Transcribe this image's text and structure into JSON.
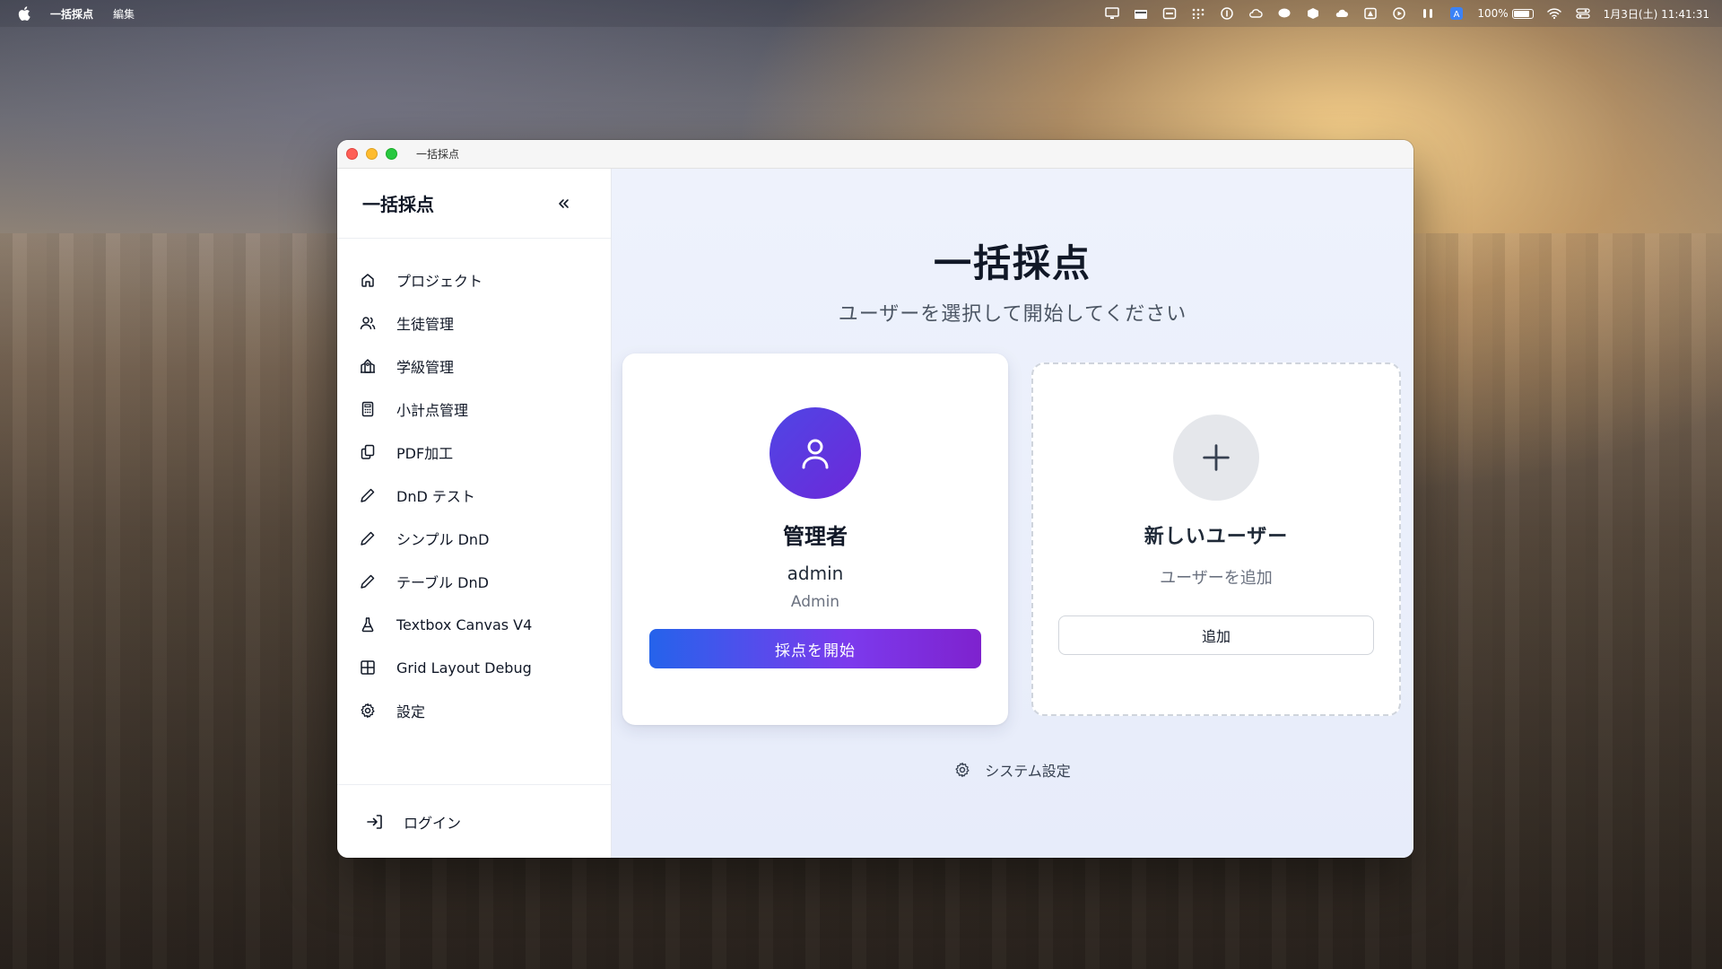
{
  "menubar": {
    "app_name": "一括採点",
    "menu_edit": "編集",
    "battery_percent": "100%",
    "datetime": "1月3日(土) 11:41:31",
    "input_indicator": "A"
  },
  "window": {
    "title": "一括採点"
  },
  "sidebar": {
    "title": "一括採点",
    "collapse_label": "«",
    "items": [
      {
        "label": "プロジェクト",
        "icon": "home-icon"
      },
      {
        "label": "生徒管理",
        "icon": "users-icon"
      },
      {
        "label": "学級管理",
        "icon": "school-icon"
      },
      {
        "label": "小計点管理",
        "icon": "calculator-icon"
      },
      {
        "label": "PDF加工",
        "icon": "files-icon"
      },
      {
        "label": "DnD テスト",
        "icon": "pencil-icon"
      },
      {
        "label": "シンプル DnD",
        "icon": "pencil-icon"
      },
      {
        "label": "テーブル DnD",
        "icon": "pencil-icon"
      },
      {
        "label": "Textbox Canvas V4",
        "icon": "flask-icon"
      },
      {
        "label": "Grid Layout Debug",
        "icon": "grid-icon"
      },
      {
        "label": "設定",
        "icon": "gear-icon"
      }
    ],
    "login_label": "ログイン"
  },
  "main": {
    "title": "一括採点",
    "subtitle": "ユーザーを選択して開始してください",
    "user_card": {
      "name": "管理者",
      "username": "admin",
      "role": "Admin",
      "start_label": "採点を開始"
    },
    "new_user_card": {
      "title": "新しいユーザー",
      "subtitle": "ユーザーを追加",
      "add_label": "追加"
    },
    "system_settings_label": "システム設定"
  },
  "colors": {
    "accent_start": "#2563eb",
    "accent_end": "#7c3aed",
    "avatar": "#5b3ee0",
    "main_bg": "#eef2fc"
  }
}
